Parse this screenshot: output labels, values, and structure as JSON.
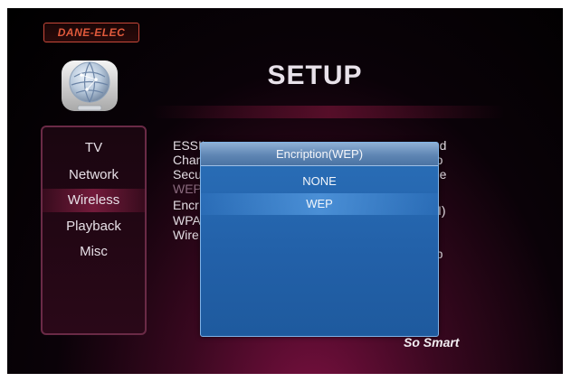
{
  "brand": {
    "logo_text": "DANE-ELEC"
  },
  "header": {
    "title": "SETUP"
  },
  "sidebar": {
    "items": [
      {
        "label": "TV"
      },
      {
        "label": "Network"
      },
      {
        "label": "Wireless",
        "selected": true
      },
      {
        "label": "Playback"
      },
      {
        "label": "Misc"
      }
    ]
  },
  "settings": {
    "rows": [
      {
        "label": "ESSID"
      },
      {
        "label": "Char"
      },
      {
        "label": "Secu"
      },
      {
        "label": "WEP"
      },
      {
        "label": "Encr"
      },
      {
        "label": "WPA"
      },
      {
        "label": "Wire"
      }
    ],
    "values": [
      {
        "value": "ned"
      },
      {
        "value": "uto"
      },
      {
        "value": "one"
      },
      {
        "value": "CII)"
      },
      {
        "value": "top"
      }
    ]
  },
  "dialog": {
    "title": "Encription(WEP)",
    "options": [
      {
        "label": "NONE"
      },
      {
        "label": "WEP",
        "highlighted": true
      }
    ]
  },
  "footer": {
    "tagline": "So Smart"
  },
  "colors": {
    "dialog_blue": "#2260a8",
    "sidebar_border": "#6a2a46",
    "brand_orange": "#e25a3c"
  }
}
